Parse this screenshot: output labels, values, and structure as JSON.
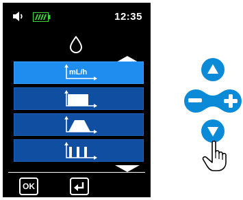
{
  "status": {
    "time": "12:35",
    "speaker_icon": "speaker-icon",
    "battery_icon": "battery-full-icon",
    "battery_color": "#3cd63c"
  },
  "infusion_icon": "drop-icon",
  "mode_list": {
    "items": [
      {
        "icon": "rate-mode-icon",
        "label": "mL/h",
        "selected": true
      },
      {
        "icon": "constant-profile-icon",
        "label": "",
        "selected": false
      },
      {
        "icon": "ramp-profile-icon",
        "label": "",
        "selected": false
      },
      {
        "icon": "intermittent-profile-icon",
        "label": "",
        "selected": false
      }
    ],
    "selected_color": "#1f8df0",
    "item_color": "#0f4ea0"
  },
  "softkeys": {
    "ok_label": "OK",
    "enter_icon": "enter-arrow-icon"
  },
  "nav_pad": {
    "accent": "#0b8ad8",
    "up_icon": "up-arrow-icon",
    "down_icon": "down-arrow-icon",
    "minus_icon": "minus-icon",
    "plus_icon": "plus-icon",
    "pointer_icon": "hand-pointer-icon"
  }
}
